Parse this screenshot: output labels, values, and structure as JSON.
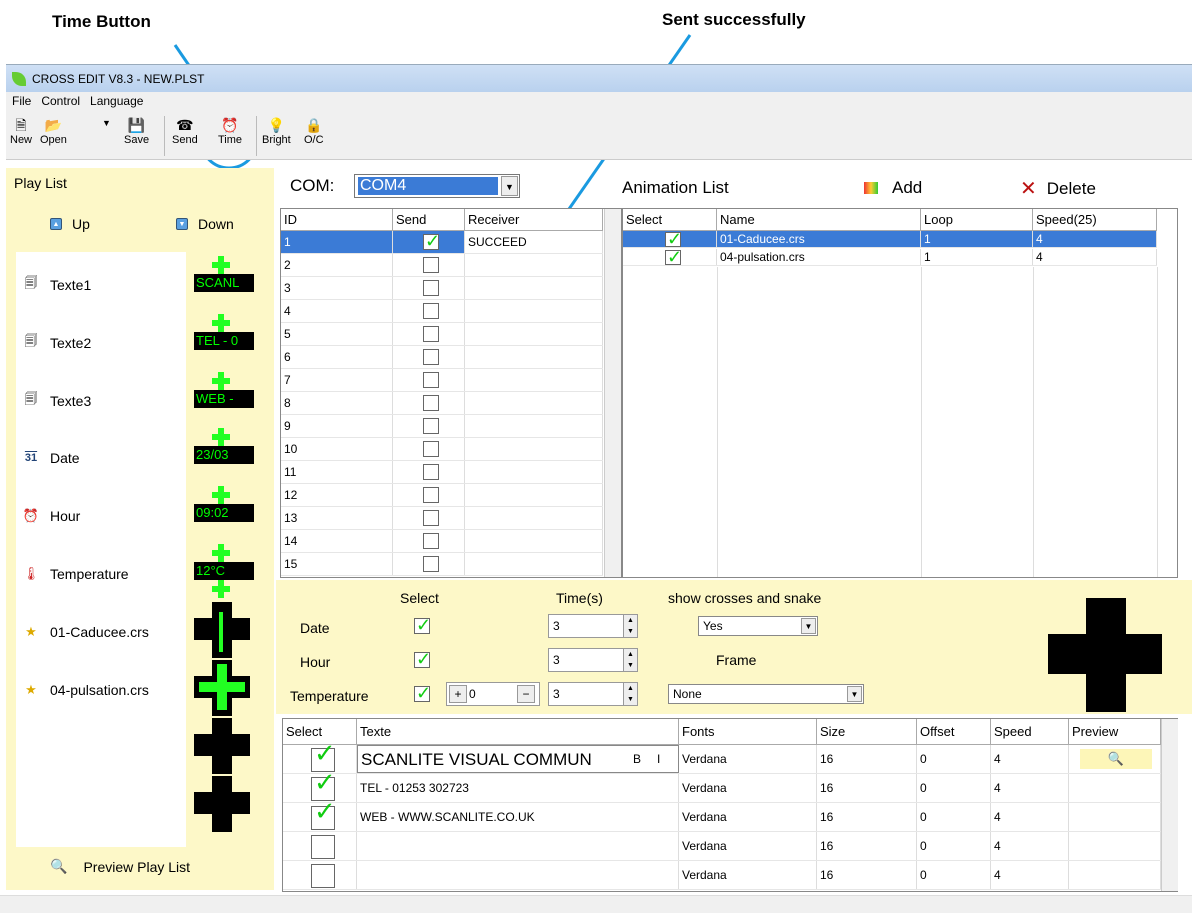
{
  "annotations": {
    "time_button": "Time Button",
    "sent": "Sent successfully"
  },
  "window": {
    "title": "CROSS EDIT V8.3 - NEW.PLST"
  },
  "menu": [
    "File",
    "Control",
    "Language"
  ],
  "toolbar": {
    "new": "New",
    "open": "Open",
    "save": "Save",
    "send": "Send",
    "time": "Time",
    "bright": "Bright",
    "oc": "O/C"
  },
  "playlist": {
    "title": "Play List",
    "up": "Up",
    "down": "Down",
    "preview": "Preview Play List",
    "items": [
      "Texte1",
      "Texte2",
      "Texte3",
      "Date",
      "Hour",
      "Temperature",
      "01-Caducee.crs",
      "04-pulsation.crs"
    ],
    "thumbs": [
      "SCANL",
      "TEL - 0",
      "WEB -",
      "23/03",
      "09:02",
      "12°C"
    ]
  },
  "com": {
    "label": "COM:",
    "value": "COM4"
  },
  "receivers": {
    "headers": [
      "ID",
      "Send",
      "Receiver"
    ],
    "status": "SUCCEED",
    "ids": [
      "1",
      "2",
      "3",
      "4",
      "5",
      "6",
      "7",
      "8",
      "9",
      "10",
      "11",
      "12",
      "13",
      "14",
      "15"
    ]
  },
  "animation": {
    "title": "Animation List",
    "add": "Add",
    "delete": "Delete",
    "headers": [
      "Select",
      "Name",
      "Loop",
      "Speed(25)"
    ],
    "rows": [
      {
        "name": "01-Caducee.crs",
        "loop": "1",
        "speed": "4"
      },
      {
        "name": "04-pulsation.crs",
        "loop": "1",
        "speed": "4"
      }
    ]
  },
  "options": {
    "select": "Select",
    "time": "Time(s)",
    "show": "show crosses and snake",
    "date": "Date",
    "hour": "Hour",
    "temperature": "Temperature",
    "date_time": "3",
    "hour_time": "3",
    "temp_time": "3",
    "temp_offset": "0",
    "show_value": "Yes",
    "frame": "Frame",
    "frame_value": "None"
  },
  "texts": {
    "headers": [
      "Select",
      "Texte",
      "Fonts",
      "Size",
      "Offset",
      "Speed",
      "Preview"
    ],
    "rows": [
      {
        "texte": "SCANLITE VISUAL COMMUN",
        "font": "Verdana",
        "size": "16",
        "offset": "0",
        "speed": "4"
      },
      {
        "texte": "TEL - 01253 302723",
        "font": "Verdana",
        "size": "16",
        "offset": "0",
        "speed": "4"
      },
      {
        "texte": "WEB - WWW.SCANLITE.CO.UK",
        "font": "Verdana",
        "size": "16",
        "offset": "0",
        "speed": "4"
      },
      {
        "texte": "",
        "font": "Verdana",
        "size": "16",
        "offset": "0",
        "speed": "4"
      },
      {
        "texte": "",
        "font": "Verdana",
        "size": "16",
        "offset": "0",
        "speed": "4"
      }
    ],
    "bold": "B",
    "italic": "I"
  },
  "colors": {
    "accent": "#3b7bd6",
    "panel": "#fdf8c8",
    "led": "#22ff22",
    "annotation": "#1a9ae0"
  }
}
